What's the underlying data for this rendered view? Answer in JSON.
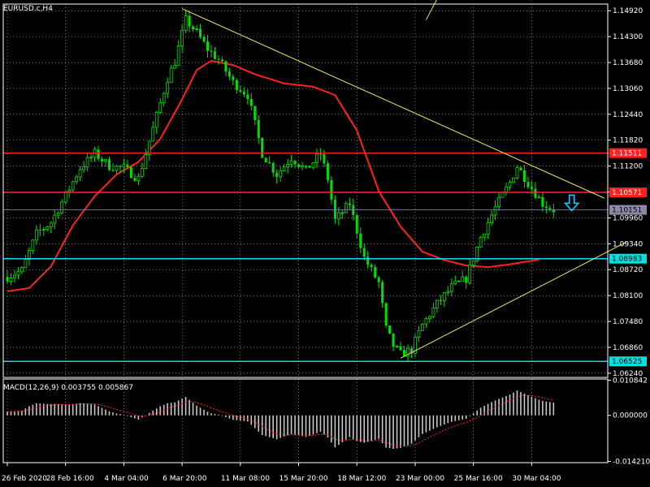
{
  "window": {
    "main_title": "EURUSD.c,H4",
    "indicator_title": "MACD(12,26,9) 0.003755 0.005867"
  },
  "colors": {
    "background": "#000000",
    "grid": "#c0c0c0",
    "axis": "#ffffff",
    "bull_candle": "#00e000",
    "bear_candle": "#00e000",
    "moving_average": "#ff2020",
    "trendline": "#e8e860",
    "red_level": "#ff2020",
    "cyan_level": "#00e0e0",
    "current_price": "#8a8aa8",
    "macd_hist": "#c8c8c8",
    "macd_signal": "#ff2020",
    "arrow": "#20c8ff"
  },
  "chart_data": {
    "type": "candlestick",
    "symbol": "EURUSD.c",
    "timeframe": "H4",
    "ylim": [
      1.0614,
      1.1508
    ],
    "price_axis_ticks": [
      "1.14920",
      "1.14300",
      "1.13680",
      "1.13060",
      "1.12440",
      "1.11820",
      "1.11200",
      "1.10580",
      "1.09960",
      "1.09340",
      "1.08720",
      "1.08100",
      "1.07480",
      "1.06860",
      "1.06240"
    ],
    "time_axis_labels": [
      {
        "label": "26 Feb 2020",
        "bar": 0
      },
      {
        "label": "28 Feb 16:00",
        "bar": 16
      },
      {
        "label": "4 Mar 04:00",
        "bar": 32
      },
      {
        "label": "6 Mar 20:00",
        "bar": 48
      },
      {
        "label": "11 Mar 08:00",
        "bar": 64
      },
      {
        "label": "15 Mar 20:00",
        "bar": 80
      },
      {
        "label": "18 Mar 12:00",
        "bar": 96
      },
      {
        "label": "23 Mar 00:00",
        "bar": 112
      },
      {
        "label": "25 Mar 16:00",
        "bar": 128
      },
      {
        "label": "30 Mar 04:00",
        "bar": 144
      }
    ],
    "horizontal_levels": [
      {
        "label": "1.11511",
        "price": 1.11511,
        "kind": "red"
      },
      {
        "label": "1.10571",
        "price": 1.10571,
        "kind": "red"
      },
      {
        "label": "1.10151",
        "price": 1.10151,
        "kind": "current"
      },
      {
        "label": "1.08983",
        "price": 1.08983,
        "kind": "cyan"
      },
      {
        "label": "1.06525",
        "price": 1.06525,
        "kind": "cyan"
      }
    ],
    "trendlines": [
      {
        "from": {
          "bar": 48,
          "price": 1.1497
        },
        "to": {
          "bar": 164,
          "price": 1.1043
        }
      },
      {
        "from": {
          "bar": 108,
          "price": 1.066
        },
        "to": {
          "bar": 170,
          "price": 1.0938
        }
      },
      {
        "from": {
          "bar": 115,
          "price": 1.147
        },
        "to": {
          "bar": 118,
          "price": 1.152
        }
      }
    ],
    "down_arrow": {
      "bar": 155,
      "price": 1.1035
    },
    "moving_average_key": [
      [
        0,
        1.082
      ],
      [
        6,
        1.0828
      ],
      [
        12,
        1.088
      ],
      [
        18,
        1.0978
      ],
      [
        24,
        1.1048
      ],
      [
        30,
        1.11
      ],
      [
        36,
        1.113
      ],
      [
        42,
        1.1185
      ],
      [
        48,
        1.128
      ],
      [
        52,
        1.135
      ],
      [
        56,
        1.1372
      ],
      [
        62,
        1.1362
      ],
      [
        68,
        1.134
      ],
      [
        76,
        1.1318
      ],
      [
        84,
        1.131
      ],
      [
        90,
        1.129
      ],
      [
        96,
        1.1205
      ],
      [
        102,
        1.106
      ],
      [
        108,
        1.0975
      ],
      [
        114,
        1.0915
      ],
      [
        120,
        1.0895
      ],
      [
        126,
        1.0882
      ],
      [
        132,
        1.0878
      ],
      [
        138,
        1.0885
      ],
      [
        146,
        1.0896
      ]
    ],
    "close_key": [
      [
        0,
        1.0855
      ],
      [
        4,
        1.087
      ],
      [
        8,
        1.0958
      ],
      [
        12,
        1.0985
      ],
      [
        16,
        1.105
      ],
      [
        20,
        1.1115
      ],
      [
        24,
        1.115
      ],
      [
        28,
        1.112
      ],
      [
        32,
        1.1115
      ],
      [
        36,
        1.109
      ],
      [
        40,
        1.121
      ],
      [
        44,
        1.133
      ],
      [
        46,
        1.137
      ],
      [
        49,
        1.147
      ],
      [
        52,
        1.144
      ],
      [
        55,
        1.14
      ],
      [
        58,
        1.1375
      ],
      [
        62,
        1.132
      ],
      [
        66,
        1.129
      ],
      [
        70,
        1.115
      ],
      [
        74,
        1.11
      ],
      [
        78,
        1.114
      ],
      [
        82,
        1.111
      ],
      [
        86,
        1.115
      ],
      [
        88,
        1.109
      ],
      [
        90,
        1.099
      ],
      [
        94,
        1.103
      ],
      [
        98,
        1.09
      ],
      [
        102,
        1.084
      ],
      [
        104,
        1.073
      ],
      [
        106,
        1.069
      ],
      [
        108,
        1.067
      ],
      [
        111,
        1.068
      ],
      [
        114,
        1.074
      ],
      [
        118,
        1.079
      ],
      [
        122,
        1.083
      ],
      [
        126,
        1.085
      ],
      [
        130,
        1.095
      ],
      [
        134,
        1.102
      ],
      [
        138,
        1.108
      ],
      [
        140,
        1.112
      ],
      [
        143,
        1.108
      ],
      [
        147,
        1.103
      ],
      [
        150,
        1.1015
      ]
    ],
    "macd_axis_ticks": [
      "0.010842",
      "0.000000",
      "-0.014210"
    ],
    "macd_ylim": [
      -0.0146,
      0.0112
    ]
  }
}
